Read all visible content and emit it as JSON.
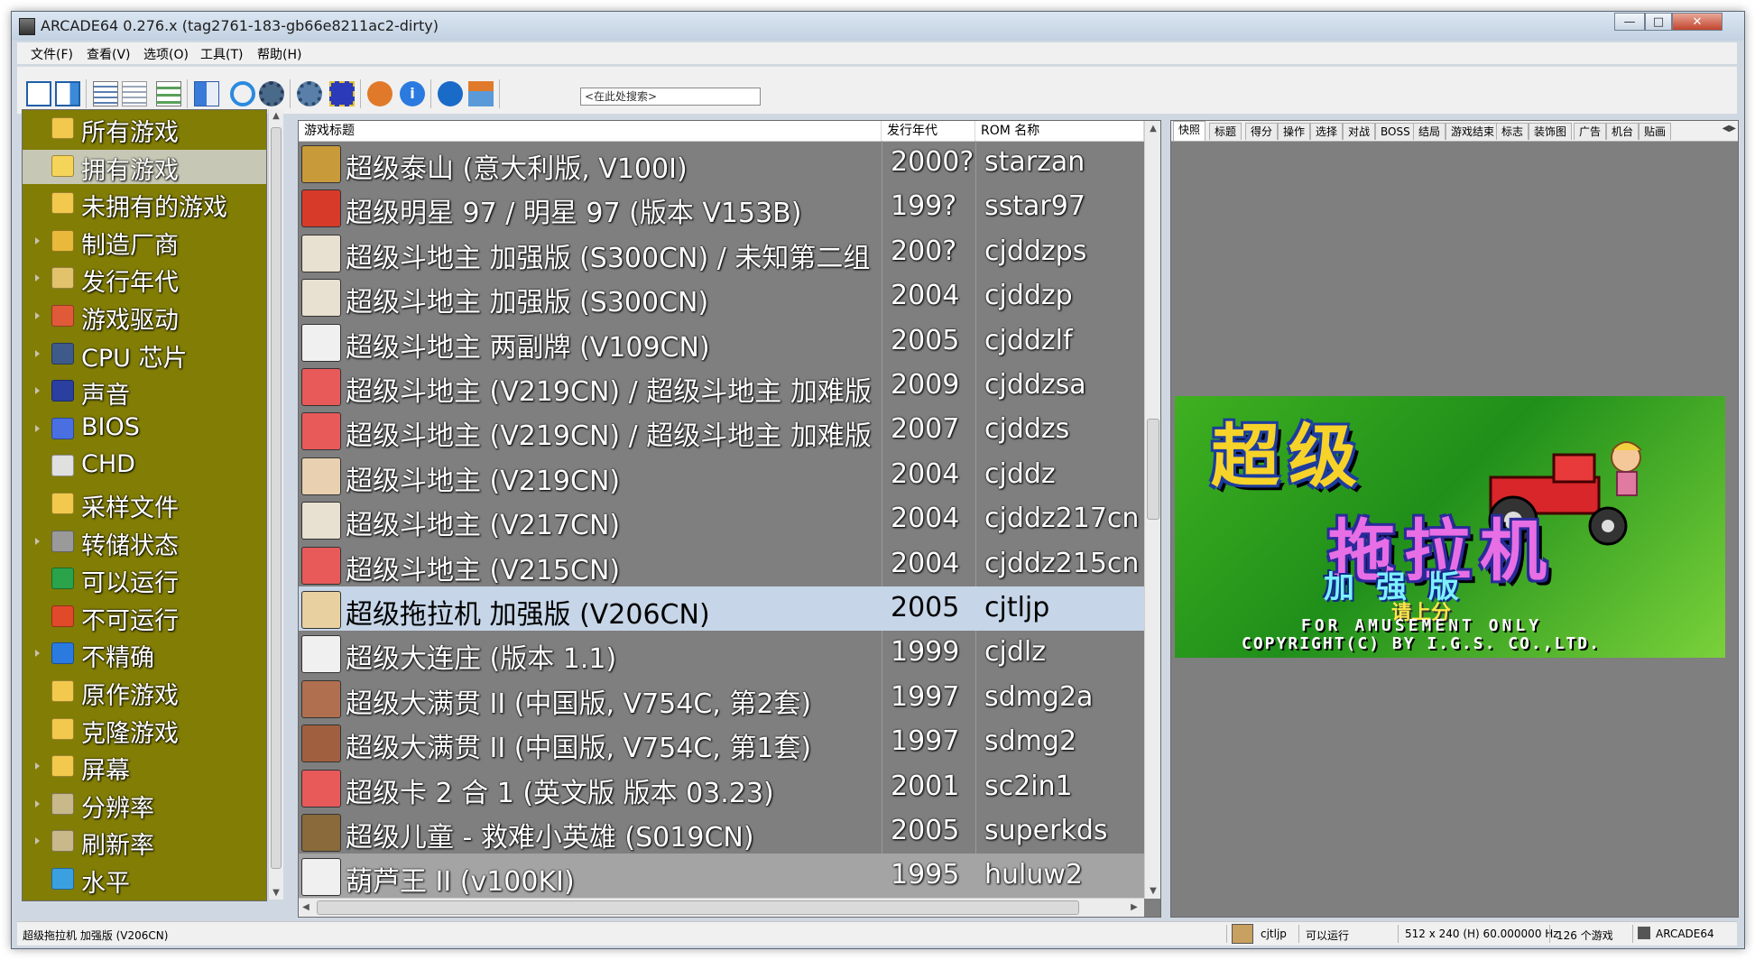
{
  "window": {
    "title": "ARCADE64 0.276.x (tag2761-183-gb66e8211ac2-dirty)",
    "minimize": "—",
    "maximize": "□",
    "close": "✕"
  },
  "menu": [
    {
      "label": "文件(F)"
    },
    {
      "label": "查看(V)"
    },
    {
      "label": "选项(O)"
    },
    {
      "label": "工具(T)"
    },
    {
      "label": "帮助(H)"
    }
  ],
  "toolbar": {
    "search_placeholder": "<在此处搜索>",
    "buttons": [
      {
        "icon": "panel-left-icon"
      },
      {
        "icon": "panel-right-icon"
      },
      {
        "icon": "details-view-icon"
      },
      {
        "icon": "list-view-icon"
      },
      {
        "icon": "grouped-view-icon"
      },
      {
        "icon": "font-view-icon"
      },
      {
        "icon": "refresh-icon"
      },
      {
        "icon": "gear-icon"
      },
      {
        "icon": "options-icon"
      },
      {
        "icon": "video-icon"
      },
      {
        "icon": "audio-icon"
      },
      {
        "icon": "info-icon"
      },
      {
        "icon": "accessibility-icon"
      },
      {
        "icon": "home-icon"
      }
    ]
  },
  "tree": {
    "items": [
      {
        "label": "所有游戏",
        "icon": "folder-all-icon",
        "color": "#f2c94c",
        "expander": false,
        "selected": false
      },
      {
        "label": "拥有游戏",
        "icon": "folder-owned-icon",
        "color": "#f5d45a",
        "expander": false,
        "selected": true
      },
      {
        "label": "未拥有的游戏",
        "icon": "folder-missing-icon",
        "color": "#f2c94c",
        "expander": false,
        "selected": false
      },
      {
        "label": "制造厂商",
        "icon": "folder-manufacturer-icon",
        "color": "#e8b93a",
        "expander": true,
        "selected": false
      },
      {
        "label": "发行年代",
        "icon": "clock-folder-icon",
        "color": "#e2c26a",
        "expander": true,
        "selected": false
      },
      {
        "label": "游戏驱动",
        "icon": "driver-icon",
        "color": "#e05a3a",
        "expander": true,
        "selected": false
      },
      {
        "label": "CPU 芯片",
        "icon": "cpu-chip-icon",
        "color": "#3e5a8a",
        "expander": true,
        "selected": false
      },
      {
        "label": "声音",
        "icon": "sound-icon",
        "color": "#2a3fa0",
        "expander": true,
        "selected": false
      },
      {
        "label": "BIOS",
        "icon": "bios-chip-icon",
        "color": "#4a6fe0",
        "expander": true,
        "selected": false
      },
      {
        "label": "CHD",
        "icon": "chd-disk-icon",
        "color": "#e0e0e0",
        "expander": false,
        "selected": false
      },
      {
        "label": "采样文件",
        "icon": "samples-folder-icon",
        "color": "#f2c94c",
        "expander": false,
        "selected": false
      },
      {
        "label": "转储状态",
        "icon": "dump-status-icon",
        "color": "#9a9a9a",
        "expander": true,
        "selected": false
      },
      {
        "label": "可以运行",
        "icon": "working-check-icon",
        "color": "#2aa34a",
        "expander": false,
        "selected": false
      },
      {
        "label": "不可运行",
        "icon": "not-working-icon",
        "color": "#e04a2a",
        "expander": false,
        "selected": false
      },
      {
        "label": "不精确",
        "icon": "imperfect-icon",
        "color": "#2a7ae0",
        "expander": true,
        "selected": false
      },
      {
        "label": "原作游戏",
        "icon": "parent-folder-icon",
        "color": "#f2c94c",
        "expander": false,
        "selected": false
      },
      {
        "label": "克隆游戏",
        "icon": "clone-folder-icon",
        "color": "#f2c94c",
        "expander": false,
        "selected": false
      },
      {
        "label": "屏幕",
        "icon": "screen-folder-icon",
        "color": "#f2c94c",
        "expander": true,
        "selected": false
      },
      {
        "label": "分辨率",
        "icon": "resolution-folder-icon",
        "color": "#c8b88a",
        "expander": true,
        "selected": false
      },
      {
        "label": "刷新率",
        "icon": "refresh-rate-folder-icon",
        "color": "#c8b88a",
        "expander": true,
        "selected": false
      },
      {
        "label": "水平",
        "icon": "horizontal-icon",
        "color": "#3aa0e0",
        "expander": false,
        "selected": false
      }
    ]
  },
  "list": {
    "headers": {
      "title": "游戏标题",
      "year": "发行年代",
      "rom": "ROM 名称"
    },
    "rows": [
      {
        "title": "超级泰山 (意大利版, V100I)",
        "year": "2000?",
        "rom": "starzan",
        "icon": "game-icon-starzan",
        "color": "#c89a3a",
        "selected": false
      },
      {
        "title": "超级明星 97 / 明星 97 (版本 V153B)",
        "year": "199?",
        "rom": "sstar97",
        "icon": "game-icon-cherries",
        "color": "#d83a2a",
        "selected": false
      },
      {
        "title": "超级斗地主 加强版 (S300CN) / 未知第二组",
        "year": "200?",
        "rom": "cjddzps",
        "icon": "game-icon-card",
        "color": "#e8e0d0",
        "selected": false
      },
      {
        "title": "超级斗地主 加强版 (S300CN)",
        "year": "2004",
        "rom": "cjddzp",
        "icon": "game-icon-card-king",
        "color": "#e8e0d0",
        "selected": false
      },
      {
        "title": "超级斗地主 两副牌 (V109CN)",
        "year": "2005",
        "rom": "cjddzlf",
        "icon": "game-icon-card-spade",
        "color": "#f0f0f0",
        "selected": false
      },
      {
        "title": "超级斗地主 (V219CN) / 超级斗地主 加难版",
        "year": "2009",
        "rom": "cjddzsa",
        "icon": "game-icon-card-red-king",
        "color": "#e85a5a",
        "selected": false
      },
      {
        "title": "超级斗地主 (V219CN) / 超级斗地主 加难版",
        "year": "2007",
        "rom": "cjddzs",
        "icon": "game-icon-card-apple",
        "color": "#e85a5a",
        "selected": false
      },
      {
        "title": "超级斗地主 (V219CN)",
        "year": "2004",
        "rom": "cjddz",
        "icon": "game-icon-card-jack",
        "color": "#e8d0b0",
        "selected": false
      },
      {
        "title": "超级斗地主 (V217CN)",
        "year": "2004",
        "rom": "cjddz217cn",
        "icon": "game-icon-card-queen",
        "color": "#e8e0d0",
        "selected": false
      },
      {
        "title": "超级斗地主 (V215CN)",
        "year": "2004",
        "rom": "cjddz215cn",
        "icon": "game-icon-card-king-red",
        "color": "#e85a5a",
        "selected": false
      },
      {
        "title": "超级拖拉机 加强版 (V206CN)",
        "year": "2005",
        "rom": "cjtljp",
        "icon": "game-icon-tractor-card",
        "color": "#e8d0a0",
        "selected": true
      },
      {
        "title": "超级大连庄 (版本 1.1)",
        "year": "1999",
        "rom": "cjdlz",
        "icon": "game-icon-card-heart",
        "color": "#f0f0f0",
        "selected": false
      },
      {
        "title": "超级大满贯 II (中国版, V754C, 第2套)",
        "year": "1997",
        "rom": "sdmg2a",
        "icon": "game-icon-portrait",
        "color": "#b07050",
        "selected": false
      },
      {
        "title": "超级大满贯 II (中国版, V754C, 第1套)",
        "year": "1997",
        "rom": "sdmg2",
        "icon": "game-icon-portrait-2",
        "color": "#a06040",
        "selected": false
      },
      {
        "title": "超级卡 2 合 1 (英文版 版本 03.23)",
        "year": "2001",
        "rom": "sc2in1",
        "icon": "game-icon-card-jack-red",
        "color": "#e85a5a",
        "selected": false
      },
      {
        "title": "超级儿童 - 救难小英雄 (S019CN)",
        "year": "2005",
        "rom": "superkds",
        "icon": "game-icon-monkey",
        "color": "#8a6a3a",
        "selected": false
      },
      {
        "title": "葫芦王 II (v100KI)",
        "year": "1995",
        "rom": "huluw2",
        "icon": "game-icon-card-eight",
        "color": "#f0f0f0",
        "selected": false,
        "alt": true
      }
    ]
  },
  "preview": {
    "tabs": [
      "快照",
      "标题",
      "得分",
      "操作",
      "选择",
      "对战",
      "BOSS",
      "结局",
      "游戏结束",
      "标志",
      "装饰图",
      "广告",
      "机台",
      "贴画"
    ],
    "active_tab": "快照",
    "snapshot": {
      "title_line1": "超级",
      "title_line2": "拖拉机",
      "edition": "加强版",
      "coin_text": "请上分",
      "amusement": "FOR AMUSEMENT ONLY",
      "copyright": "COPYRIGHT(C) BY I.G.S. CO.,LTD."
    }
  },
  "statusbar": {
    "selected_title": "超级拖拉机 加强版 (V206CN)",
    "rom": "cjtljp",
    "status": "可以运行",
    "resolution": "512 x 240 (H) 60.000000 Hz",
    "count": "126 个游戏",
    "app": "ARCADE64"
  }
}
